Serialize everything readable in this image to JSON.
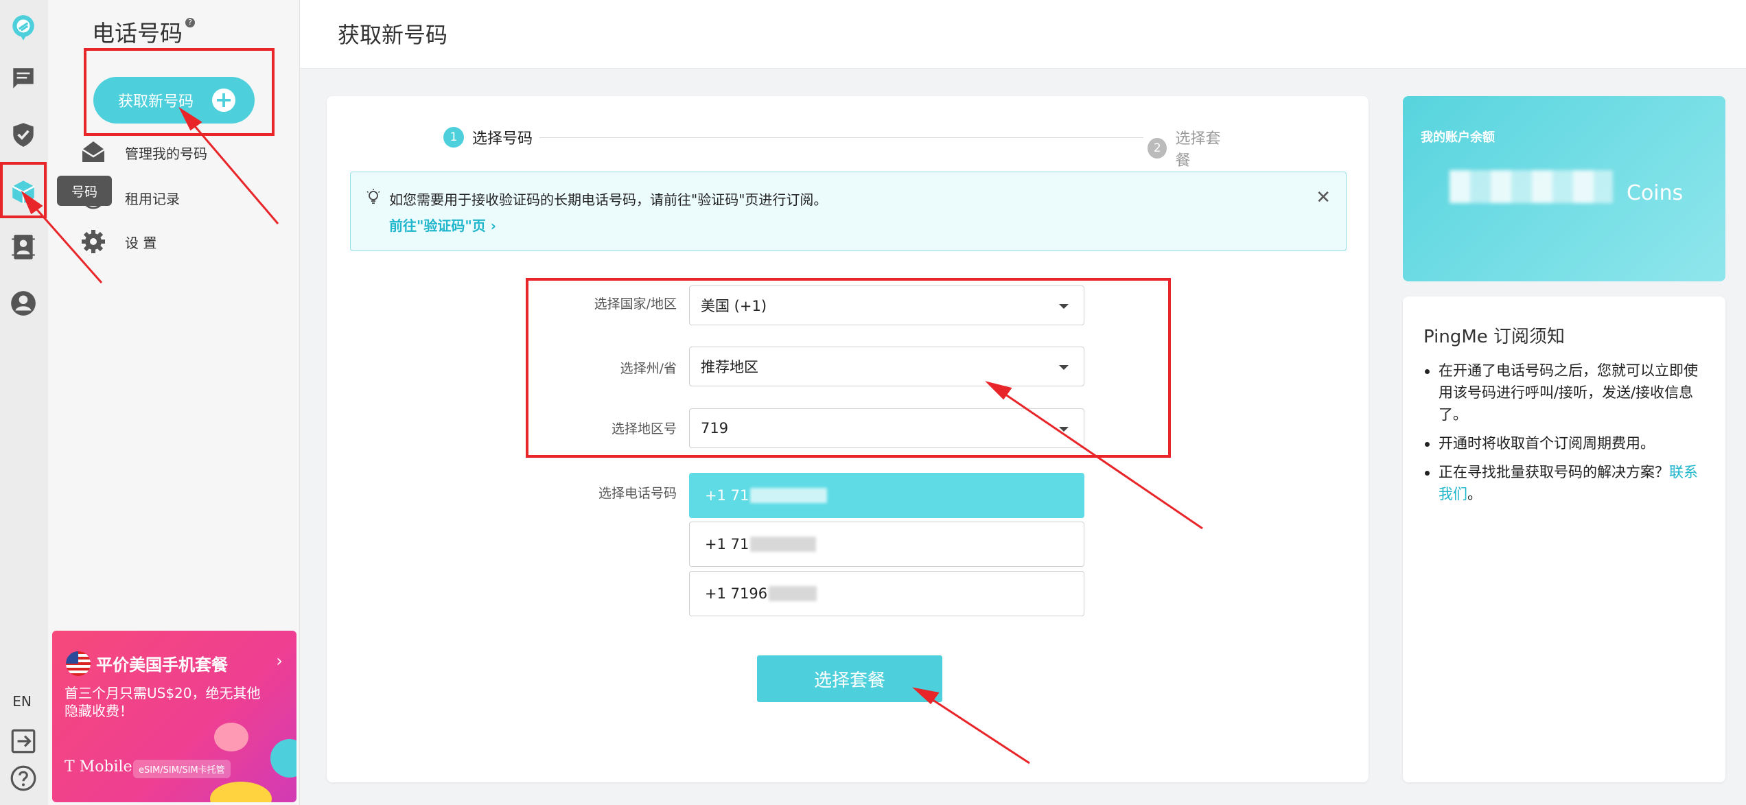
{
  "rail": {
    "items": [
      "logo",
      "messages",
      "verification",
      "numbers",
      "contacts",
      "account"
    ],
    "lang": "EN",
    "tooltip": "号码"
  },
  "sidebar": {
    "title": "电话号码",
    "help": "?",
    "get_button": "获取新号码",
    "items": [
      {
        "label": "管理我的号码",
        "icon": "envelope-icon"
      },
      {
        "label": "租用记录",
        "icon": "history-icon"
      },
      {
        "label": "设 置",
        "icon": "gear-icon"
      }
    ]
  },
  "promo": {
    "title": "平价美国手机套餐",
    "arrow": "›",
    "desc": "首三个月只需US$20，绝无其他隐藏收费！",
    "brand": "T Mobile",
    "chip": "eSIM/SIM/SIM卡托管"
  },
  "header": {
    "title": "获取新号码"
  },
  "steps": [
    {
      "num": "1",
      "label": "选择号码",
      "active": true
    },
    {
      "num": "2",
      "label": "选择套餐",
      "active": false
    }
  ],
  "notice": {
    "text": "如您需要用于接收验证码的长期电话号码，请前往\"验证码\"页进行订阅。",
    "link": "前往\"验证码\"页 ›",
    "close": "✕"
  },
  "form": {
    "country_label": "选择国家/地区",
    "country_value": "美国 (+1)",
    "state_label": "选择州/省",
    "state_value": "推荐地区",
    "area_label": "选择地区号",
    "area_value": "719",
    "number_label": "选择电话号码",
    "numbers": [
      "+1 71",
      "+1 71",
      "+1 7196"
    ],
    "submit": "选择套餐"
  },
  "balance": {
    "label": "我的账户余额",
    "unit": "Coins"
  },
  "notes": {
    "title": "PingMe 订阅须知",
    "items": [
      "在开通了电话号码之后，您就可以立即使用该号码进行呼叫/接听，发送/接收信息了。",
      "开通时将收取首个订阅周期费用。",
      "正在寻找批量获取号码的解决方案？"
    ],
    "contact_link": "联系我们",
    "contact_suffix": "。"
  },
  "colors": {
    "accent": "#4dd0dc",
    "link": "#1fb6cc",
    "annotation": "#e8262a"
  }
}
